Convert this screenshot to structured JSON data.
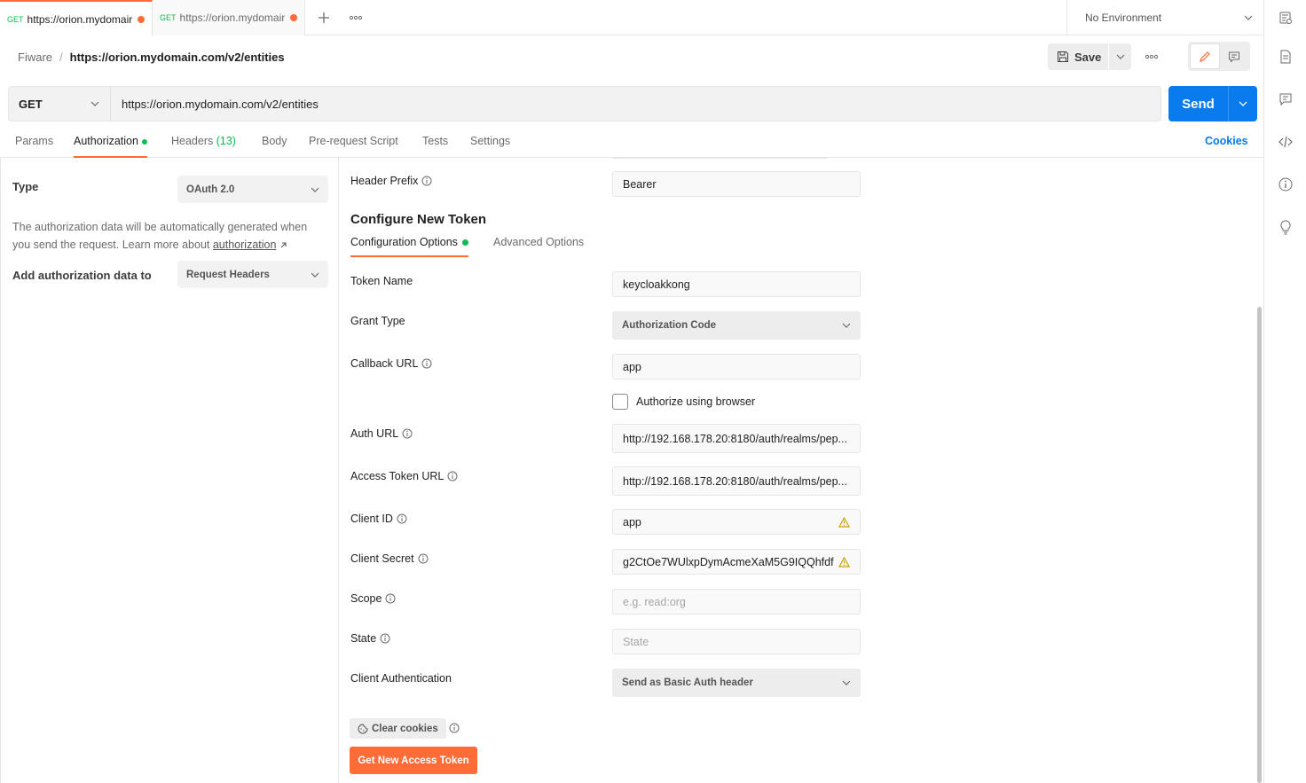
{
  "tabs": [
    {
      "method": "GET",
      "title": "https://orion.mydomair"
    },
    {
      "method": "GET",
      "title": "https://orion.mydomair"
    }
  ],
  "environment": {
    "label": "No Environment"
  },
  "breadcrumb": {
    "collection": "Fiware",
    "separator": "/",
    "request": "https://orion.mydomain.com/v2/entities"
  },
  "toolbar": {
    "save_label": "Save"
  },
  "request": {
    "method": "GET",
    "url": "https://orion.mydomain.com/v2/entities",
    "send_label": "Send"
  },
  "request_tabs": {
    "params": "Params",
    "authorization": "Authorization",
    "headers": "Headers",
    "headers_count": "(13)",
    "body": "Body",
    "pre_request": "Pre-request Script",
    "tests": "Tests",
    "settings": "Settings",
    "cookies": "Cookies"
  },
  "auth": {
    "type_label": "Type",
    "type_value": "OAuth 2.0",
    "description": "The authorization data will be automatically generated when you send the request. Learn more about ",
    "description_link": "authorization",
    "add_to_label": "Add authorization data to",
    "add_to_value": "Request Headers"
  },
  "token_config": {
    "header_prefix_label": "Header Prefix",
    "header_prefix_value": "Bearer",
    "section_title": "Configure New Token",
    "tab_config": "Configuration Options",
    "tab_advanced": "Advanced Options",
    "fields": {
      "token_name": {
        "label": "Token Name",
        "value": "keycloakkong"
      },
      "grant_type": {
        "label": "Grant Type",
        "value": "Authorization Code"
      },
      "callback_url": {
        "label": "Callback URL",
        "value": "app"
      },
      "authorize_browser": {
        "label": "Authorize using browser",
        "checked": false
      },
      "auth_url": {
        "label": "Auth URL",
        "value": "http://192.168.178.20:8180/auth/realms/pep..."
      },
      "access_token_url": {
        "label": "Access Token URL",
        "value": "http://192.168.178.20:8180/auth/realms/pep..."
      },
      "client_id": {
        "label": "Client ID",
        "value": "app"
      },
      "client_secret": {
        "label": "Client Secret",
        "value": "g2CtOe7WUlxpDymAcmeXaM5G9IQQhfdf"
      },
      "scope": {
        "label": "Scope",
        "placeholder": "e.g. read:org"
      },
      "state": {
        "label": "State",
        "placeholder": "State"
      },
      "client_auth": {
        "label": "Client Authentication",
        "value": "Send as Basic Auth header"
      }
    },
    "clear_cookies_label": "Clear cookies",
    "get_token_label": "Get New Access Token"
  },
  "colors": {
    "accent": "#ff6c37",
    "primary": "#097bed",
    "success": "#0cbb52",
    "warning": "#c9a100"
  }
}
